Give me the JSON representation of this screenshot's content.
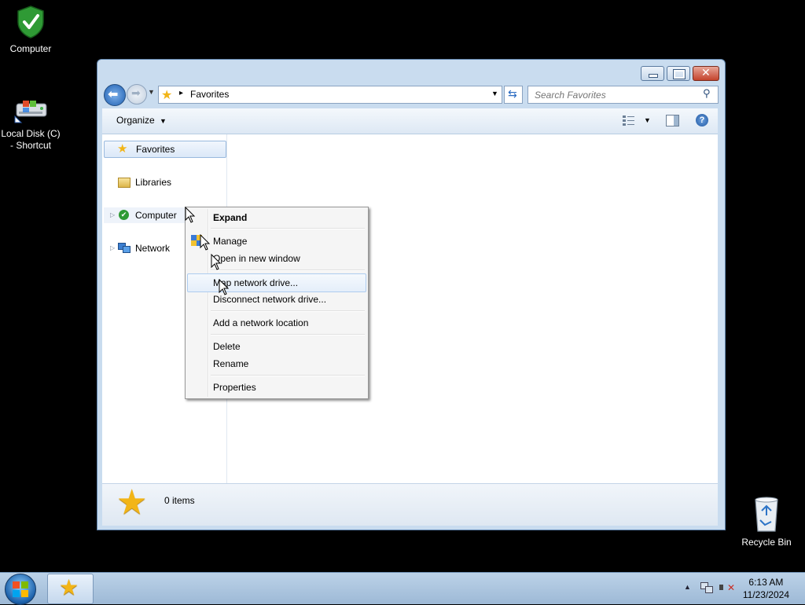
{
  "desktop": {
    "icons": [
      {
        "label": "Computer"
      },
      {
        "label_line1": "Local Disk (C)",
        "label_line2": "- Shortcut"
      },
      {
        "label": "Recycle Bin"
      }
    ]
  },
  "window": {
    "address": {
      "crumb": "Favorites"
    },
    "search": {
      "placeholder": "Search Favorites"
    },
    "toolbar": {
      "organize": "Organize"
    },
    "nav": {
      "items": [
        {
          "label": "Favorites",
          "icon": "star-icon"
        },
        {
          "label": "Libraries",
          "icon": "libraries-icon"
        },
        {
          "label": "Computer",
          "icon": "computer-icon"
        },
        {
          "label": "Network",
          "icon": "network-icon"
        }
      ]
    },
    "details": {
      "count": "0 items"
    }
  },
  "context_menu": {
    "items": [
      {
        "label": "Expand"
      },
      {
        "label": "Manage"
      },
      {
        "label": "Open in new window"
      },
      {
        "label": "Map network drive..."
      },
      {
        "label": "Disconnect network drive..."
      },
      {
        "label": "Add a network location"
      },
      {
        "label": "Delete"
      },
      {
        "label": "Rename"
      },
      {
        "label": "Properties"
      }
    ]
  },
  "taskbar": {
    "time": "6:13 AM",
    "date": "11/23/2024"
  },
  "colors": {
    "desktop": "#000000",
    "menu_highlight": "#e4eefa",
    "window_frame": "#c9dcef"
  }
}
